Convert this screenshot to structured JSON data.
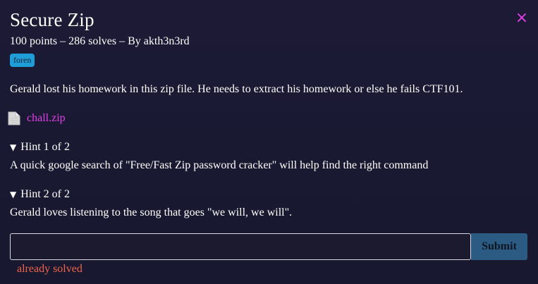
{
  "challenge": {
    "title": "Secure Zip",
    "subtitle": "100 points – 286 solves – By akth3n3rd",
    "tag": "foren",
    "description": "Gerald lost his homework in this zip file. He needs to extract his homework or else he fails CTF101.",
    "file_name": "chall.zip"
  },
  "close_icon": "×",
  "hints": [
    {
      "triangle": "▼",
      "label": "Hint 1 of 2",
      "text": "A quick google search of \"Free/Fast Zip password cracker\" will help find the right command"
    },
    {
      "triangle": "▼",
      "label": "Hint 2 of 2",
      "text": "Gerald loves listening to the song that goes \"we will, we will\"."
    }
  ],
  "form": {
    "input_value": "",
    "input_placeholder": "",
    "submit_label": "Submit",
    "status": "already solved"
  },
  "colors": {
    "accent": "#e040e8",
    "tag_bg": "#1f9dd9",
    "submit_bg": "#2b5b83",
    "status": "#f0644a",
    "background": "#1a1830"
  }
}
